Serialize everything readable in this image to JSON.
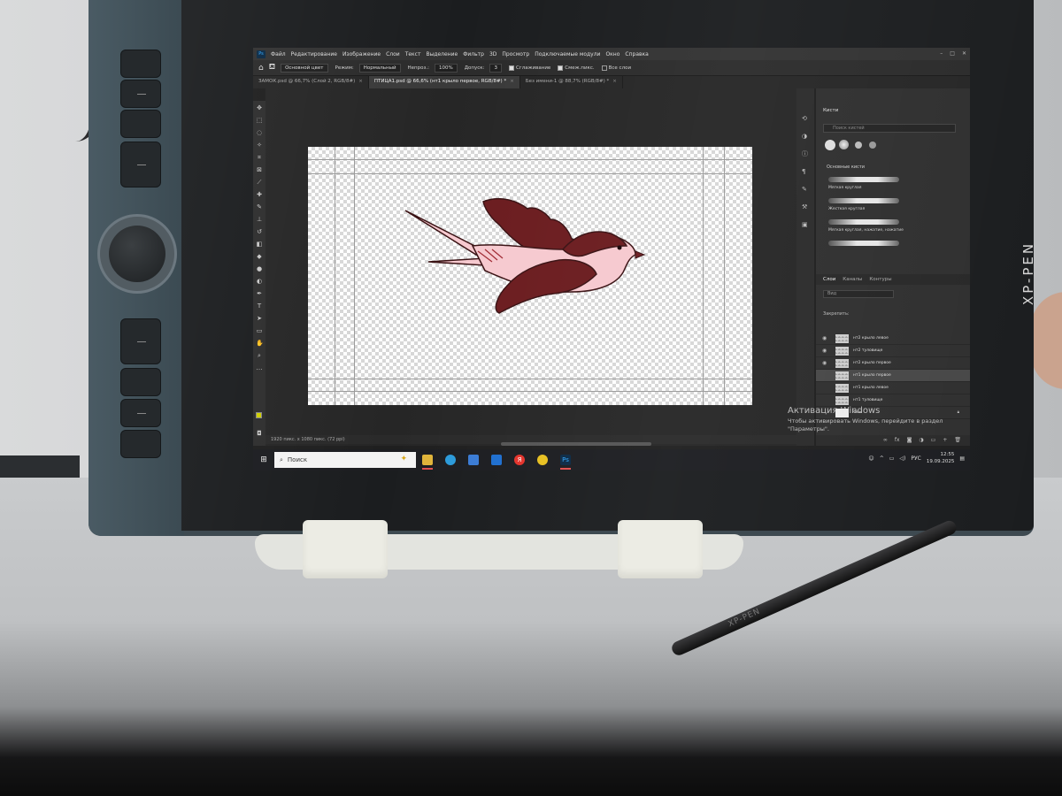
{
  "device": {
    "brand": "XP-PEN",
    "pen_brand": "XP-PEN"
  },
  "app": {
    "logo": "Ps",
    "menu": [
      "Файл",
      "Редактирование",
      "Изображение",
      "Слои",
      "Текст",
      "Выделение",
      "Фильтр",
      "3D",
      "Просмотр",
      "Подключаемые модули",
      "Окно",
      "Справка"
    ],
    "options": {
      "preset": "Основной цвет",
      "mode_label": "Режим:",
      "mode_value": "Нормальный",
      "opacity_label": "Непроз.:",
      "opacity_value": "100%",
      "tolerance_label": "Допуск:",
      "tolerance_value": "3",
      "antialias_label": "Сглаживание",
      "contiguous_label": "Смеж.пикс.",
      "all_layers_label": "Все слои"
    },
    "tabs": [
      {
        "label": "ЗАМОК.psd @ 66,7% (Слой 2, RGB/8#)",
        "active": false
      },
      {
        "label": "ПТИЦА1.psd @ 66,6% (нт1 крыло первое, RGB/8#) *",
        "active": true
      },
      {
        "label": "Без имени-1 @ 88,7% (RGB/8#) *",
        "active": false
      }
    ],
    "status": "1920 пикс. x 1080 пикс. (72 ppi)"
  },
  "brushes_panel": {
    "title": "Кисти",
    "search_placeholder": "Поиск кистей",
    "folder": "Основные кисти",
    "items": [
      "Мягкая круглая",
      "Жесткая круглая",
      "Мягкая круглая, нажатие, нажатие"
    ]
  },
  "layers_panel": {
    "tabs": [
      "Слои",
      "Каналы",
      "Контуры"
    ],
    "search_placeholder": "Вид",
    "lock_label": "Закрепить:",
    "layers": [
      {
        "name": "нт2 крыло левое",
        "visible": true,
        "selected": false
      },
      {
        "name": "нт2 туловище",
        "visible": true,
        "selected": false
      },
      {
        "name": "нт2 крыло первое",
        "visible": true,
        "selected": false
      },
      {
        "name": "нт1 крыло первое",
        "visible": false,
        "selected": true
      },
      {
        "name": "нт1 крыло левое",
        "visible": false,
        "selected": false
      },
      {
        "name": "нт1 туловище",
        "visible": false,
        "selected": false
      },
      {
        "name": "Фон",
        "visible": false,
        "selected": false
      }
    ]
  },
  "activation": {
    "title": "Активация Windows",
    "subtitle": "Чтобы активировать Windows, перейдите в раздел \"Параметры\"."
  },
  "taskbar": {
    "search_placeholder": "Поиск",
    "language": "РУС",
    "time": "12:55",
    "date": "19.09.2025"
  },
  "colors": {
    "wing_dark": "#6b1c1f",
    "body_pink": "#f6c9cf",
    "outline": "#3a1214",
    "foreground_swatch": "#cfcf00"
  }
}
